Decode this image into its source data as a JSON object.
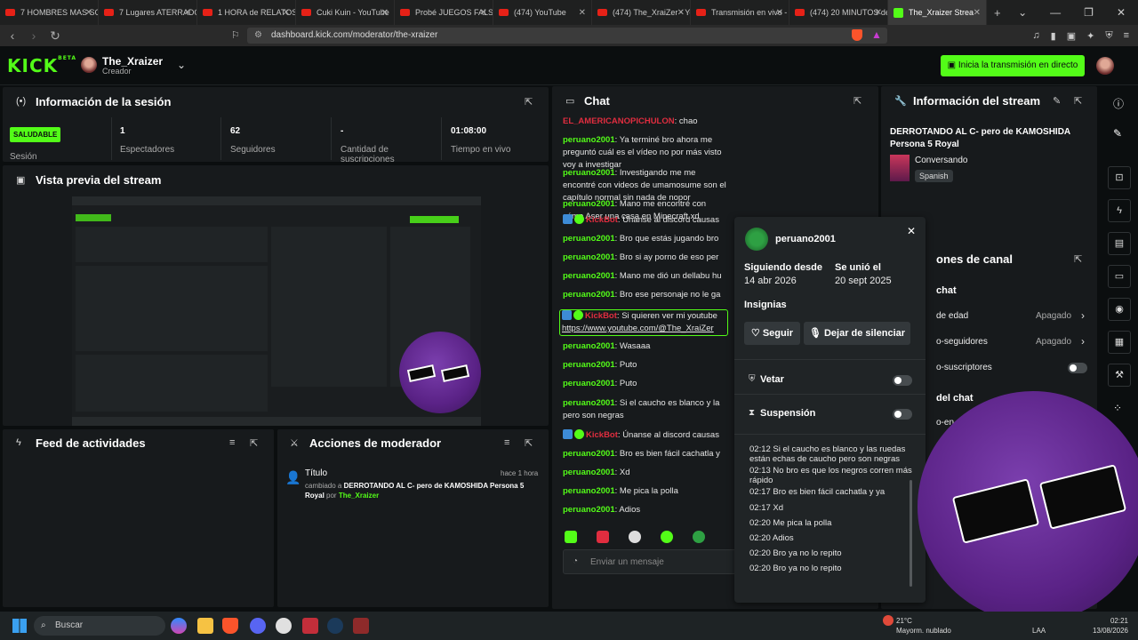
{
  "browser": {
    "tabs": [
      {
        "title": "7 HOMBRES MAS SOB",
        "kind": "yt"
      },
      {
        "title": "7 Lugares ATERRADOR",
        "kind": "yt"
      },
      {
        "title": "1 HORA de RELATOS D",
        "kind": "yt"
      },
      {
        "title": "Cuki Kuin - YouTube",
        "kind": "yt"
      },
      {
        "title": "Probé JUEGOS FALSOS",
        "kind": "yt"
      },
      {
        "title": "(474) YouTube",
        "kind": "yt"
      },
      {
        "title": "(474) The_XraiZer - Yo",
        "kind": "yt"
      },
      {
        "title": "Transmisión en vivo -",
        "kind": "yt"
      },
      {
        "title": "(474) 20 MINUTOS de",
        "kind": "yt"
      },
      {
        "title": "The_Xraizer Strea",
        "kind": "kick",
        "active": true
      }
    ],
    "new_tab": "+",
    "url": "dashboard.kick.com/moderator/the-xraizer"
  },
  "header": {
    "logo": "KICK",
    "logo_badge": "BETA",
    "channel_name": "The_Xraizer",
    "channel_role": "Creador",
    "go_live_label": "Inicia la transmisión en directo"
  },
  "session": {
    "title": "Información de la sesión",
    "status_badge": "SALUDABLE",
    "status_label": "Sesión",
    "stats": [
      {
        "value": "1",
        "label": "Espectadores"
      },
      {
        "value": "62",
        "label": "Seguidores"
      },
      {
        "value": "-",
        "label": "Cantidad de suscripciones"
      },
      {
        "value": "01:08:00",
        "label": "Tiempo en vivo"
      }
    ]
  },
  "preview": {
    "title": "Vista previa del stream"
  },
  "feed": {
    "title": "Feed de actividades"
  },
  "mod_actions": {
    "title": "Acciones de moderador",
    "item": {
      "label": "Título",
      "time": "hace 1 hora",
      "changed": "cambiado a",
      "new_title": "DERROTANDO AL C- pero de KAMOSHIDA Persona 5 Royal",
      "by": "por",
      "user": "The_Xraizer"
    }
  },
  "chat": {
    "title": "Chat",
    "input_placeholder": "Enviar un mensaje",
    "messages": [
      {
        "user": "EL_AMERICANOPICHULON",
        "text": "chao",
        "bot": false,
        "red": true
      },
      {
        "user": "peruano2001",
        "text": "Ya terminé bro ahora me preguntó cuál es el vídeo no por más visto voy a investigar"
      },
      {
        "user": "peruano2001",
        "text": "Investigando me me encontré con videos de umamosume son el capítulo normal sin nada de nopor"
      },
      {
        "user": "peruano2001",
        "text": "Mano me encontré con cómo Aser una casa en Minecraft xd"
      },
      {
        "user": "KickBot",
        "text": "Únanse al discord causas",
        "bot": true
      },
      {
        "user": "peruano2001",
        "text": "Bro que estás jugando bro"
      },
      {
        "user": "peruano2001",
        "text": "Bro si ay porno de eso per"
      },
      {
        "user": "peruano2001",
        "text": "Mano me dió un dellabu hu"
      },
      {
        "user": "peruano2001",
        "text": "Bro ese personaje no le ga"
      },
      {
        "user": "KickBot",
        "text": "Si quieren ver mi youtube",
        "link": "https://www.youtube.com/@The_XraiZer",
        "bot": true
      },
      {
        "user": "peruano2001",
        "text": "Wasaaa"
      },
      {
        "user": "peruano2001",
        "text": "Puto"
      },
      {
        "user": "peruano2001",
        "text": "Puto"
      },
      {
        "user": "peruano2001",
        "text": "Si el caucho es blanco y la pero son negras"
      },
      {
        "user": "KickBot",
        "text": "Únanse al discord causas",
        "bot": true
      },
      {
        "user": "peruano2001",
        "text": "Bro es bien fácil cachatla y"
      },
      {
        "user": "peruano2001",
        "text": "Xd"
      },
      {
        "user": "peruano2001",
        "text": "Me pica la polla"
      },
      {
        "user": "peruano2001",
        "text": "Adios"
      }
    ]
  },
  "stream_info": {
    "title": "Información del stream",
    "stream_title": "DERROTANDO AL C- pero de KAMOSHIDA Persona 5 Royal",
    "category": "Conversando",
    "language": "Spanish",
    "channel_options_title": "ones de canal",
    "chat_section": "chat",
    "options": [
      {
        "label": "de edad",
        "value": "Apagado"
      },
      {
        "label": "o-seguidores",
        "value": "Apagado"
      },
      {
        "label": "o-suscriptores",
        "value": ""
      }
    ],
    "chat_section2": "del chat",
    "partial": "o-en"
  },
  "popup": {
    "username": "peruano2001",
    "following_label": "Siguiendo desde",
    "following_date": "14 abr 2026",
    "joined_label": "Se unió el",
    "joined_date": "20 sept 2025",
    "badges_label": "Insignias",
    "follow_btn": "Seguir",
    "unmute_btn": "Dejar de silenciar",
    "ban_label": "Vetar",
    "timeout_label": "Suspensión",
    "history": [
      {
        "time": "02:12",
        "text": "Si el caucho es blanco y las ruedas están echas de caucho pero son negras"
      },
      {
        "time": "02:13",
        "text": "No bro es que los negros corren más rápido"
      },
      {
        "time": "02:17",
        "text": "Bro es bien fácil cachatla y ya"
      },
      {
        "time": "02:17",
        "text": "Xd"
      },
      {
        "time": "02:20",
        "text": "Me pica la polla"
      },
      {
        "time": "02:20",
        "text": "Adios"
      },
      {
        "time": "02:20",
        "text": "Bro ya no lo repito"
      },
      {
        "time": "02:20",
        "text": "Bro ya no lo repito"
      }
    ]
  },
  "taskbar": {
    "search_placeholder": "Buscar",
    "weather_temp": "21°C",
    "weather_desc": "Mayorm. nublado",
    "lang": "LAA",
    "time": "02:21",
    "date": "13/08/2026"
  },
  "colors": {
    "brand": "#53fc18",
    "panel": "#171a1c",
    "bg": "#0b0e0f",
    "bot": "#e02d3f"
  }
}
